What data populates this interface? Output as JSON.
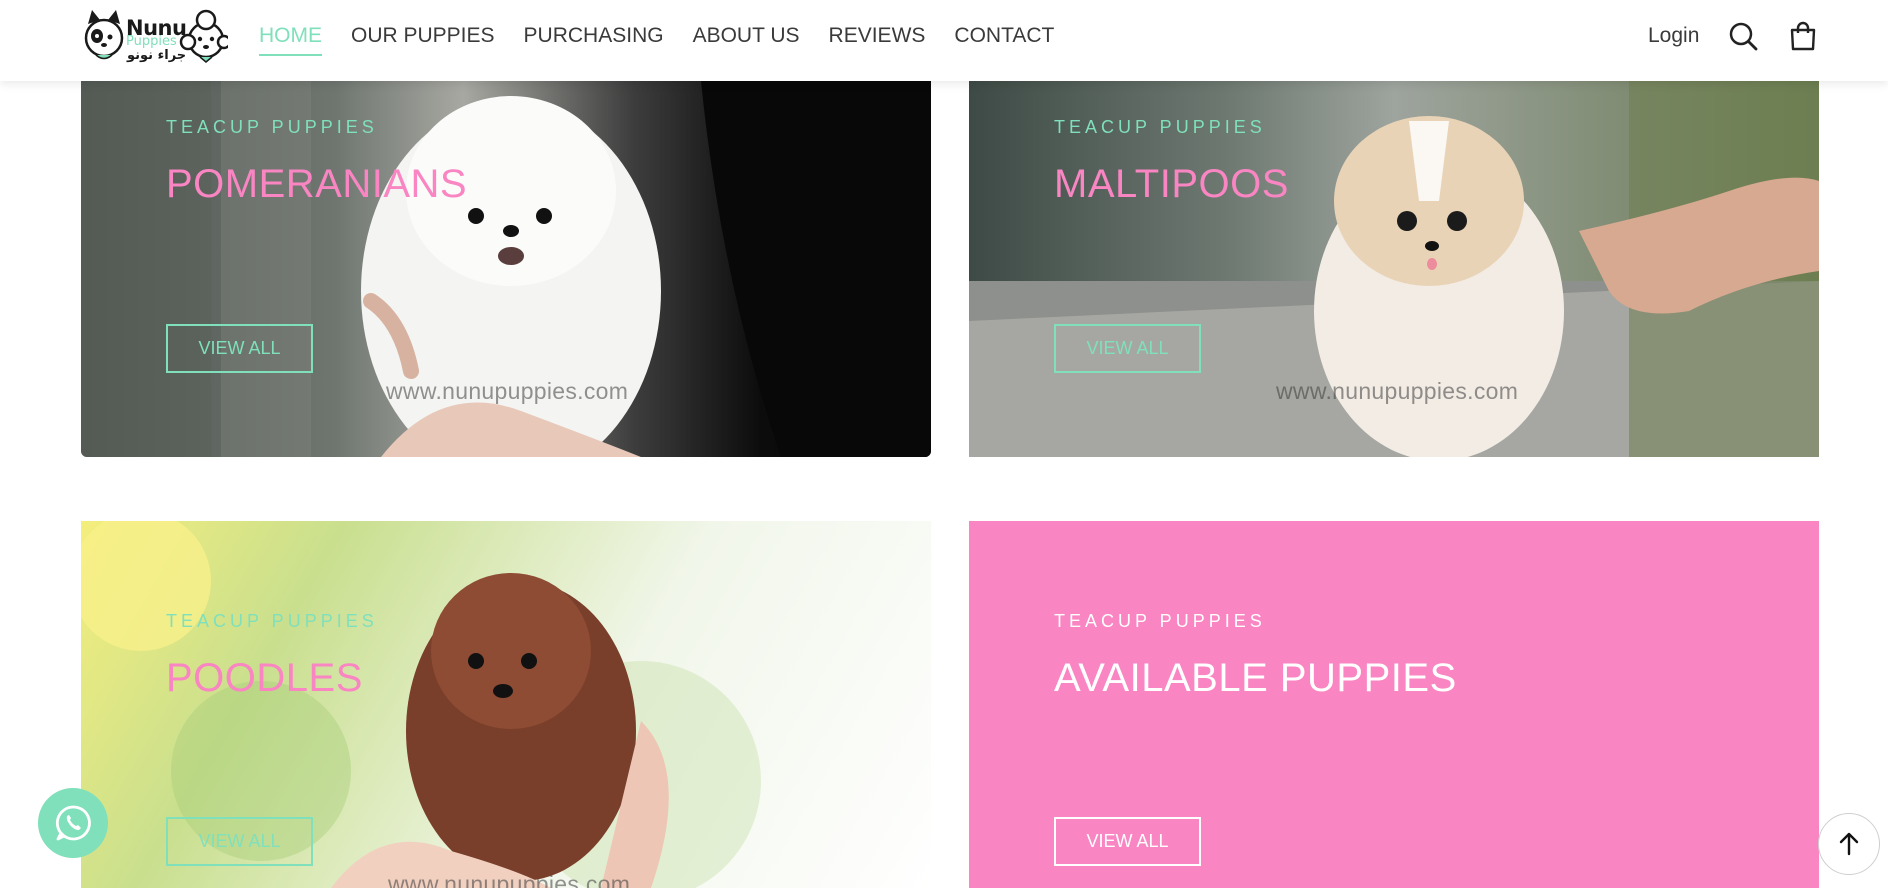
{
  "brand": {
    "name": "Nunu",
    "sub": "Puppies",
    "arabic": "جراء نونو",
    "accent": "#7fe0bb",
    "pink": "#f985c2"
  },
  "nav": {
    "items": [
      {
        "label": "HOME",
        "active": true
      },
      {
        "label": "OUR PUPPIES"
      },
      {
        "label": "PURCHASING"
      },
      {
        "label": "ABOUT US"
      },
      {
        "label": "REVIEWS"
      },
      {
        "label": "CONTACT"
      }
    ],
    "login": "Login",
    "icons": [
      "search-icon",
      "shopping-bag-icon"
    ]
  },
  "cards": [
    {
      "eyebrow": "TEACUP PUPPIES",
      "title": "POMERANIANS",
      "button": "VIEW ALL",
      "watermark": "www.nunupuppies.com"
    },
    {
      "eyebrow": "TEACUP PUPPIES",
      "title": "MALTIPOOS",
      "button": "VIEW ALL",
      "watermark": "www.nunupuppies.com"
    },
    {
      "eyebrow": "TEACUP PUPPIES",
      "title": "POODLES",
      "button": "VIEW ALL",
      "watermark": "www.nunupuppies.com"
    },
    {
      "eyebrow": "TEACUP PUPPIES",
      "title": "AVAILABLE PUPPIES",
      "button": "VIEW ALL"
    }
  ],
  "floating": {
    "whatsapp_icon": "whatsapp-icon",
    "scroll_top_icon": "arrow-up-icon"
  }
}
